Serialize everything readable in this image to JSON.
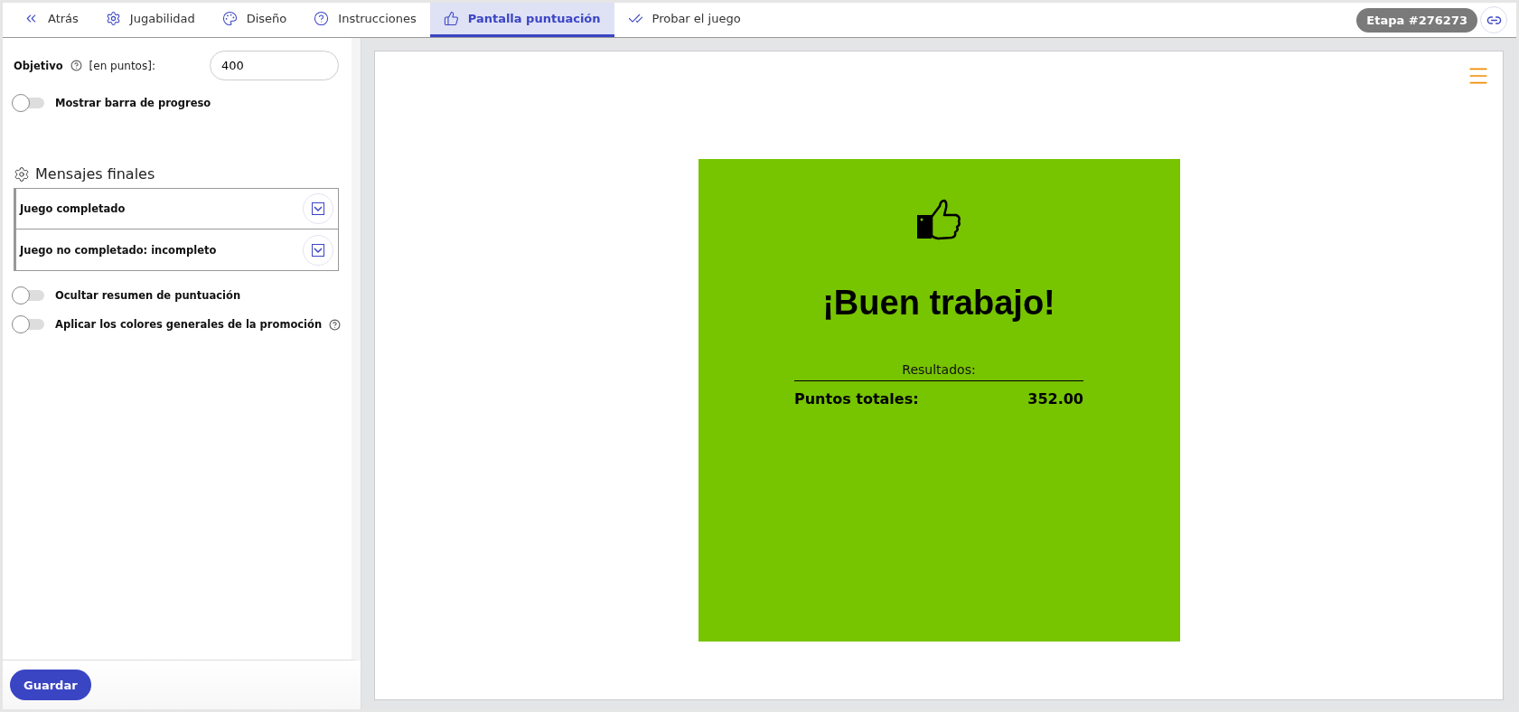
{
  "tabs": [
    {
      "label": "Atrás",
      "selected": false
    },
    {
      "label": "Jugabilidad",
      "selected": false
    },
    {
      "label": "Diseño",
      "selected": false
    },
    {
      "label": "Instrucciones",
      "selected": false
    },
    {
      "label": "Pantalla puntuación",
      "selected": true
    },
    {
      "label": "Probar el juego",
      "selected": false
    }
  ],
  "stage_badge": "Etapa #276273",
  "settings": {
    "goal": {
      "label": "Objetivo",
      "unit": "[en puntos]:",
      "value": "400"
    },
    "progress_toggle": {
      "label": "Mostrar barra de progreso",
      "on": false
    },
    "section_title": "Mensajes finales",
    "messages": [
      {
        "label": "Juego completado",
        "expanded": false
      },
      {
        "label": "Juego no completado: incompleto",
        "expanded": false
      }
    ],
    "toggles": [
      {
        "label": "Ocultar resumen de puntuación",
        "on": false,
        "kind": "plain"
      },
      {
        "label": "Aplicar los colores generales de la promoción",
        "on": false,
        "kind": "with_help"
      }
    ]
  },
  "save_button": "Guardar",
  "preview": {
    "title": "¡Buen trabajo!",
    "results_label": "Resultados:",
    "total_label": "Puntos totales:",
    "total_value": "352.00"
  }
}
